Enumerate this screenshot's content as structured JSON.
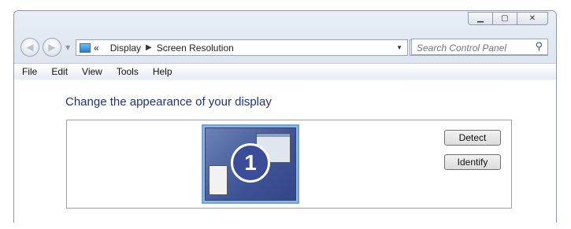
{
  "window": {
    "caption_buttons": {
      "minimize": "▁",
      "maximize": "▢",
      "close": "✕"
    }
  },
  "nav": {
    "back_icon": "back-arrow-icon",
    "forward_icon": "forward-arrow-icon",
    "breadcrumb": {
      "overflow": "«",
      "items": [
        "Display",
        "Screen Resolution"
      ]
    },
    "search_placeholder": "Search Control Panel"
  },
  "menu": {
    "items": [
      "File",
      "Edit",
      "View",
      "Tools",
      "Help"
    ]
  },
  "main": {
    "heading": "Change the appearance of your display",
    "monitor_number": "1",
    "detect_label": "Detect",
    "identify_label": "Identify"
  }
}
